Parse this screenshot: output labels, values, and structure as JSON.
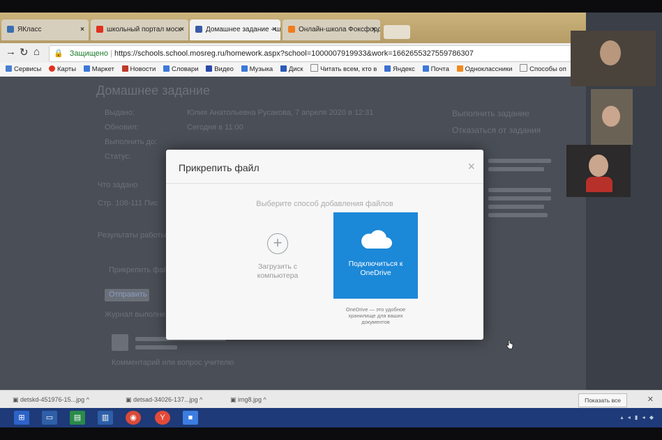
{
  "browser": {
    "tabs": [
      {
        "label": "ЯКласс",
        "active": false
      },
      {
        "label": "школьный портал моск",
        "active": false
      },
      {
        "label": "Домашнее задание - ш",
        "active": true
      },
      {
        "label": "Онлайн-школа Фоксфорд",
        "active": false
      }
    ],
    "security_label": "Защищено",
    "url": "https://schools.school.mosreg.ru/homework.aspx?school=1000007919933&work=1662655327559786307",
    "bookmarks": [
      "Сервисы",
      "Карты",
      "Маркет",
      "Новости",
      "Словари",
      "Видео",
      "Музыка",
      "Диск",
      "Читать всем, кто в",
      "Яндекс",
      "Почта",
      "Одноклассники",
      "Способы оп"
    ]
  },
  "page": {
    "heading": "Домашнее задание",
    "meta_labels": [
      "Выданo:",
      "Обновил:",
      "Выполнить до:",
      "Статус:"
    ],
    "meta_values": [
      "Юлия Анатольевна Русакова, 7 апреля 2020 в 12:31",
      "Сегодня в 11:00"
    ],
    "right_actions": [
      "Выполнить задание",
      "Отказаться от задания"
    ],
    "section_task": "Что задано",
    "task_text": "Стр. 108-111 Пис",
    "section_result": "Результаты работы",
    "attach_link": "Прикрепить файл",
    "submit_button": "Отправить",
    "journal": "Журнал выполнения",
    "comment_placeholder": "Комментарий или вопрос учителю"
  },
  "modal": {
    "title": "Прикрепить файл",
    "close": "×",
    "hint": "Выберите способ добавления файлов",
    "upload_label": "Загрузить с компьютера",
    "onedrive_label": "Подключиться к OneDrive",
    "onedrive_note": "OneDrive — это удобное хранилище для ваших документов"
  },
  "downloads": {
    "items": [
      "detskd-451976-15...jpg",
      "detsad-34026-137...jpg",
      "img8.jpg"
    ],
    "show_all": "Показать все",
    "close": "✕"
  },
  "colors": {
    "onedrive_blue": "#1c88d8",
    "taskbar": "#1e3a78",
    "tab_strip": "#cbb37c"
  }
}
